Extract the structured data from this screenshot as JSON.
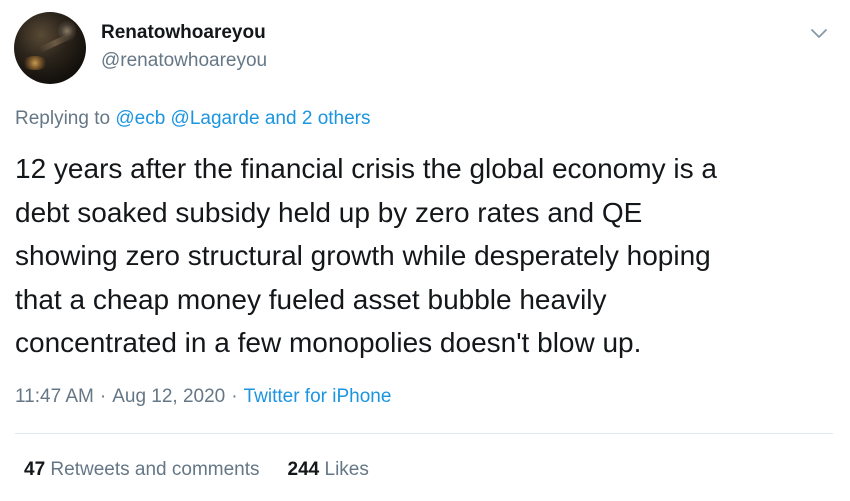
{
  "user": {
    "display_name": "Renatowhoareyou",
    "handle": "@renatowhoareyou",
    "avatar_icon": "user-avatar-photo"
  },
  "header": {
    "more_icon": "chevron-down-icon"
  },
  "reply": {
    "prefix": "Replying to",
    "mentions": [
      "@ecb",
      "@Lagarde"
    ],
    "conjunction": "and",
    "others": "2 others"
  },
  "tweet": {
    "text": "12 years after the financial crisis the global economy is a\ndebt soaked subsidy held up by zero rates and QE\nshowing zero structural growth while desperately hoping\nthat a cheap money fueled asset bubble heavily\nconcentrated in a few monopolies doesn't blow up."
  },
  "meta": {
    "time": "11:47 AM",
    "separator": "·",
    "date": "Aug 12, 2020",
    "source": "Twitter for iPhone"
  },
  "stats": {
    "retweets_count": "47",
    "retweets_label": "Retweets and comments",
    "likes_count": "244",
    "likes_label": "Likes"
  },
  "colors": {
    "link": "#1b95e0",
    "secondary_text": "#657786",
    "primary_text": "#14171a",
    "divider": "#e1e8ed"
  }
}
